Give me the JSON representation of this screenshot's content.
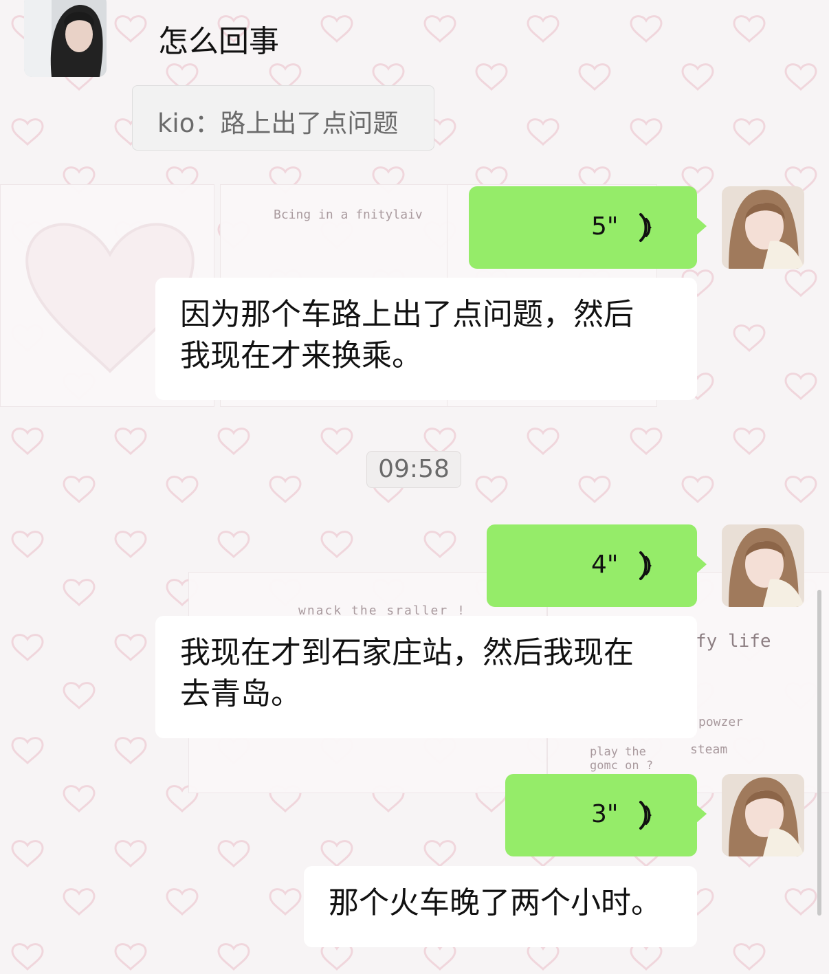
{
  "chat": {
    "contact_message": "怎么回事",
    "quote": "kio：路上出了点问题",
    "messages": [
      {
        "duration": "5\"",
        "transcript_line1": "因为那个车路上出了点问题，然后",
        "transcript_line2": "我现在才来换乘。"
      },
      {
        "duration": "4\"",
        "transcript_line1": "我现在才到石家庄站，然后我现在",
        "transcript_line2": "去青岛。"
      },
      {
        "duration": "3\"",
        "transcript_line1": "那个火车晚了两个小时。"
      }
    ],
    "timestamp": "09:58"
  },
  "background_art": {
    "card1_title": "Bcing in a fnitylaiv",
    "card2_title": "wnack the sraller !",
    "card3_a": "fy life",
    "card3_b": "powzer",
    "card3_c": "steam",
    "card3_d": "play the gomc on ?"
  },
  "colors": {
    "voice_bubble": "#95ec69",
    "transcript_bg": "#ffffff",
    "timestamp_bg": "#f0eeee"
  },
  "icons": {
    "voice": "voice-wave-icon"
  }
}
